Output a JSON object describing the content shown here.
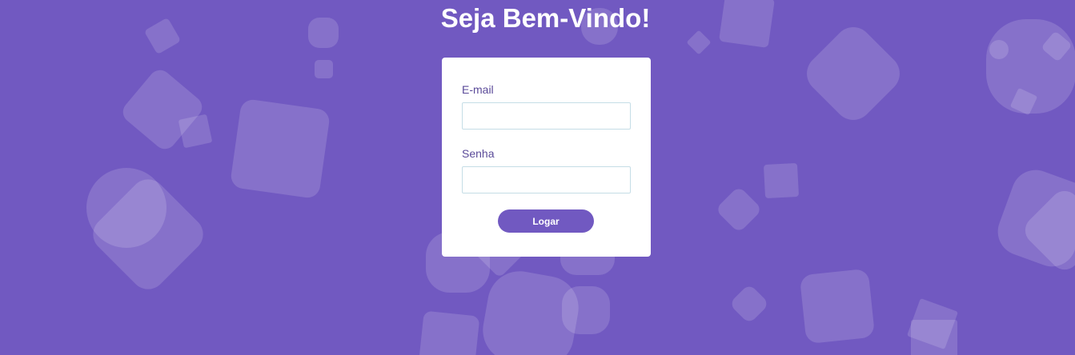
{
  "page": {
    "title": "Seja Bem-Vindo!"
  },
  "form": {
    "email_label": "E-mail",
    "email_value": "",
    "password_label": "Senha",
    "password_value": "",
    "login_button": "Logar"
  },
  "colors": {
    "background": "#7159c1",
    "card": "#ffffff",
    "button": "#7159c1",
    "input_border": "#c5dde6"
  }
}
